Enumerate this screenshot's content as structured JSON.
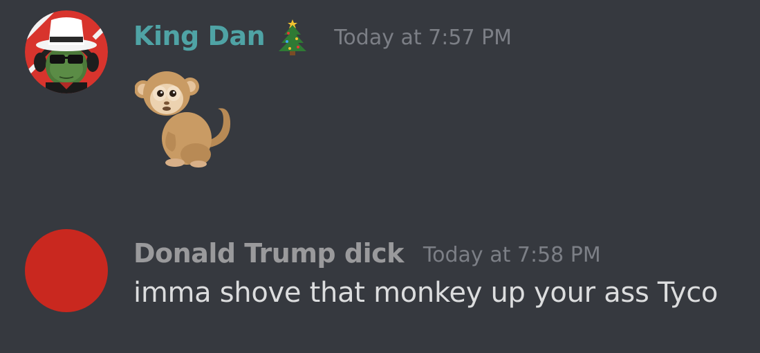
{
  "messages": [
    {
      "username": "King Dan",
      "username_color": "#4fa3a5",
      "badge_icon": "christmas-tree-icon",
      "timestamp": "Today at 7:57 PM",
      "avatar": "top-hat-character-avatar",
      "content_emoji": "monkey-emoji"
    },
    {
      "username": "Donald Trump dick",
      "username_color": "#9a9a9c",
      "timestamp": "Today at 7:58 PM",
      "avatar_color": "#c9281f",
      "content": "imma shove that monkey up your ass Tyco"
    }
  ],
  "colors": {
    "background": "#36393f",
    "timestamp": "#7c7f86",
    "message_text": "#dcddde"
  }
}
